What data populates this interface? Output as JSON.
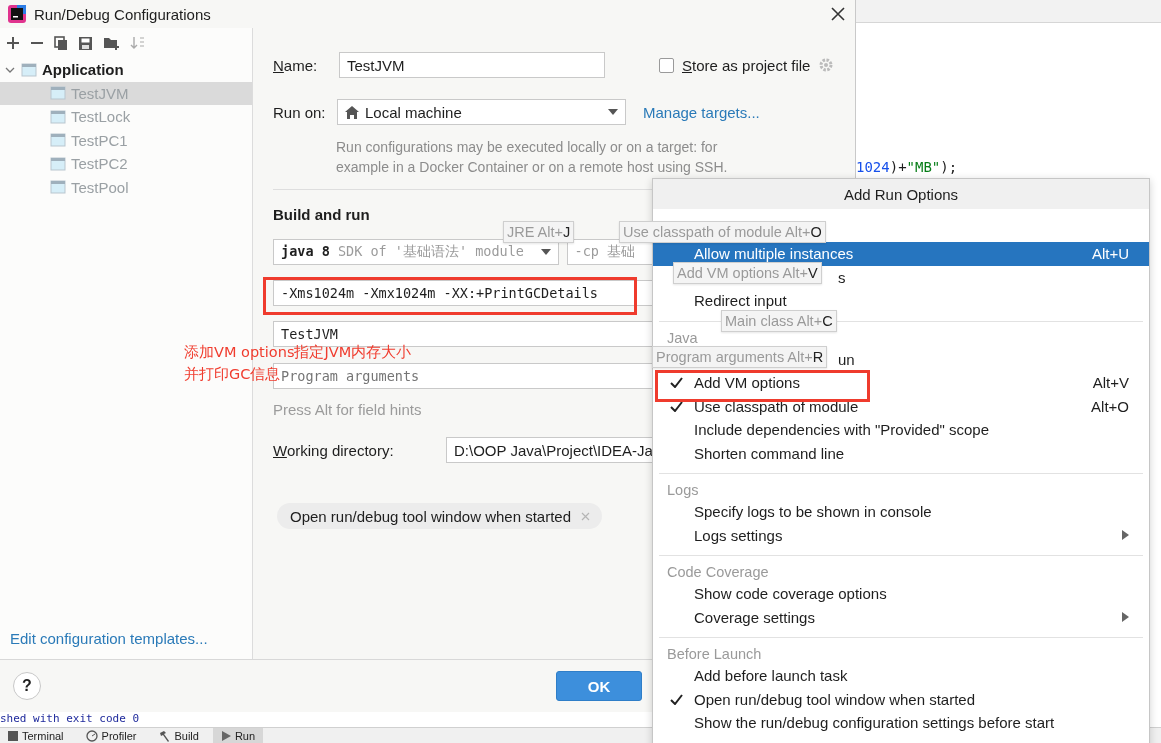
{
  "window": {
    "title": "Run/Debug Configurations"
  },
  "tree": {
    "label": "Application",
    "expanded": true,
    "children": [
      {
        "label": "TestJVM",
        "selected": true
      },
      {
        "label": "TestLock",
        "selected": false
      },
      {
        "label": "TestPC1",
        "selected": false
      },
      {
        "label": "TestPC2",
        "selected": false
      },
      {
        "label": "TestPool",
        "selected": false
      }
    ]
  },
  "templates_link": "Edit configuration templates...",
  "form": {
    "name_label": "Name:",
    "name": "TestJVM",
    "store_checkbox": {
      "label": "Store as project file",
      "checked": false
    },
    "run_on_label": "Run on:",
    "run_on": "Local machine",
    "manage_link": "Manage targets...",
    "description": "Run configurations may be executed locally or on a target: for example in a Docker Container or on a remote host using SSH.",
    "section": "Build and run",
    "jre": {
      "version": "java 8",
      "detail": "SDK of '基础语法' module"
    },
    "classpath": "-cp 基础",
    "vm_options": "-Xms1024m -Xmx1024m -XX:+PrintGCDetails",
    "main_class": "TestJVM",
    "program_args_placeholder": "Program arguments",
    "hint": "Press Alt for field hints",
    "wd_label": "Working directory:",
    "wd": "D:\\OOP Java\\Project\\IDEA-Ja",
    "chip": "Open run/debug tool window when started"
  },
  "footer": {
    "help": "?",
    "ok": "OK"
  },
  "editor": {
    "code": [
      {
        "text": "1024",
        "kind": "number"
      },
      {
        "text": ")+",
        "kind": "plain"
      },
      {
        "text": "\"MB\"",
        "kind": "string"
      },
      {
        "text": ");",
        "kind": "plain"
      }
    ]
  },
  "console": {
    "text": "shed with exit code 0"
  },
  "tool_tabs": [
    {
      "label": "Terminal",
      "kind": "terminal",
      "selected": false
    },
    {
      "label": "Profiler",
      "kind": "profiler",
      "selected": false
    },
    {
      "label": "Build",
      "kind": "build",
      "selected": false
    },
    {
      "label": "Run",
      "kind": "run",
      "selected": true
    }
  ],
  "menu": {
    "title": "Add Run Options",
    "groups": [
      {
        "items": [
          {
            "label": "Allow multiple instances",
            "shortcut": "Alt+U",
            "kind": "option",
            "selected": true,
            "checked": false,
            "submenu": false
          },
          {
            "label": "s",
            "kind": "fragment",
            "selected": false,
            "checked": false,
            "submenu": false
          },
          {
            "label": "Redirect input",
            "kind": "option",
            "selected": false,
            "checked": false,
            "submenu": false
          }
        ]
      },
      {
        "title": "Java",
        "items": [
          {
            "label": "un",
            "kind": "fragment",
            "selected": false,
            "checked": false,
            "submenu": false
          },
          {
            "label": "Add VM options",
            "shortcut": "Alt+V",
            "kind": "option",
            "selected": false,
            "checked": true,
            "submenu": false
          },
          {
            "label": "Use classpath of module",
            "shortcut": "Alt+O",
            "kind": "option",
            "selected": false,
            "checked": true,
            "submenu": false
          },
          {
            "label": "Include dependencies with \"Provided\" scope",
            "kind": "option",
            "selected": false,
            "checked": false,
            "submenu": false
          },
          {
            "label": "Shorten command line",
            "kind": "option",
            "selected": false,
            "checked": false,
            "submenu": false
          }
        ]
      },
      {
        "title": "Logs",
        "items": [
          {
            "label": "Specify logs to be shown in console",
            "kind": "option",
            "selected": false,
            "checked": false,
            "submenu": false
          },
          {
            "label": "Logs settings",
            "kind": "option",
            "selected": false,
            "checked": false,
            "submenu": true
          }
        ]
      },
      {
        "title": "Code Coverage",
        "items": [
          {
            "label": "Show code coverage options",
            "kind": "option",
            "selected": false,
            "checked": false,
            "submenu": false
          },
          {
            "label": "Coverage settings",
            "kind": "option",
            "selected": false,
            "checked": false,
            "submenu": true
          }
        ]
      },
      {
        "title": "Before Launch",
        "items": [
          {
            "label": "Add before launch task",
            "kind": "option",
            "selected": false,
            "checked": false,
            "submenu": false
          },
          {
            "label": "Open run/debug tool window when started",
            "kind": "option",
            "selected": false,
            "checked": true,
            "submenu": false
          },
          {
            "label": "Show the run/debug configuration settings before start",
            "kind": "option",
            "selected": false,
            "checked": false,
            "submenu": false
          }
        ]
      }
    ]
  },
  "hints": [
    "JRE Alt+**J**",
    "Use classpath of module Alt+**O**",
    "Add VM options Alt+**V**",
    "Main class Alt+**C**",
    "Program arguments Alt+**R**"
  ],
  "annotation": {
    "lines": [
      "添加VM options指定JVM内存大小",
      "并打印GC信息"
    ]
  }
}
